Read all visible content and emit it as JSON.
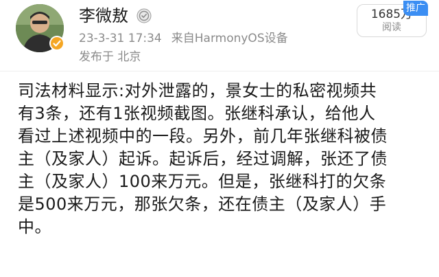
{
  "header": {
    "avatar_icon": "user-avatar",
    "verified_icon": "verified-badge-icon",
    "username": "李微敖",
    "level_icon": "user-level-icon",
    "timestamp": "23-3-31 17:34",
    "source": "来自HarmonyOS设备",
    "location": "发布于 北京"
  },
  "stats": {
    "read_count": "1685万",
    "read_label": "阅读",
    "promo_tag": "推广"
  },
  "post": {
    "lines": [
      "司法材料显示:对外泄露的，景女士的私密视频共",
      "有3条，还有1张视频截图。张继科承认，给他人",
      "看过上述视频中的一段。另外，前几年张继科被债",
      "主（及家人）起诉。起诉后，经过调解，张还了债",
      "主（及家人）100来万元。但是，张继科打的欠条",
      "是500来万元，那张欠条，还在债主（及家人）手",
      "中。"
    ]
  },
  "colors": {
    "promo_blue": "#3b8ef3",
    "meta_gray": "#8a8a8a",
    "verified_orange": "#f5a623"
  }
}
